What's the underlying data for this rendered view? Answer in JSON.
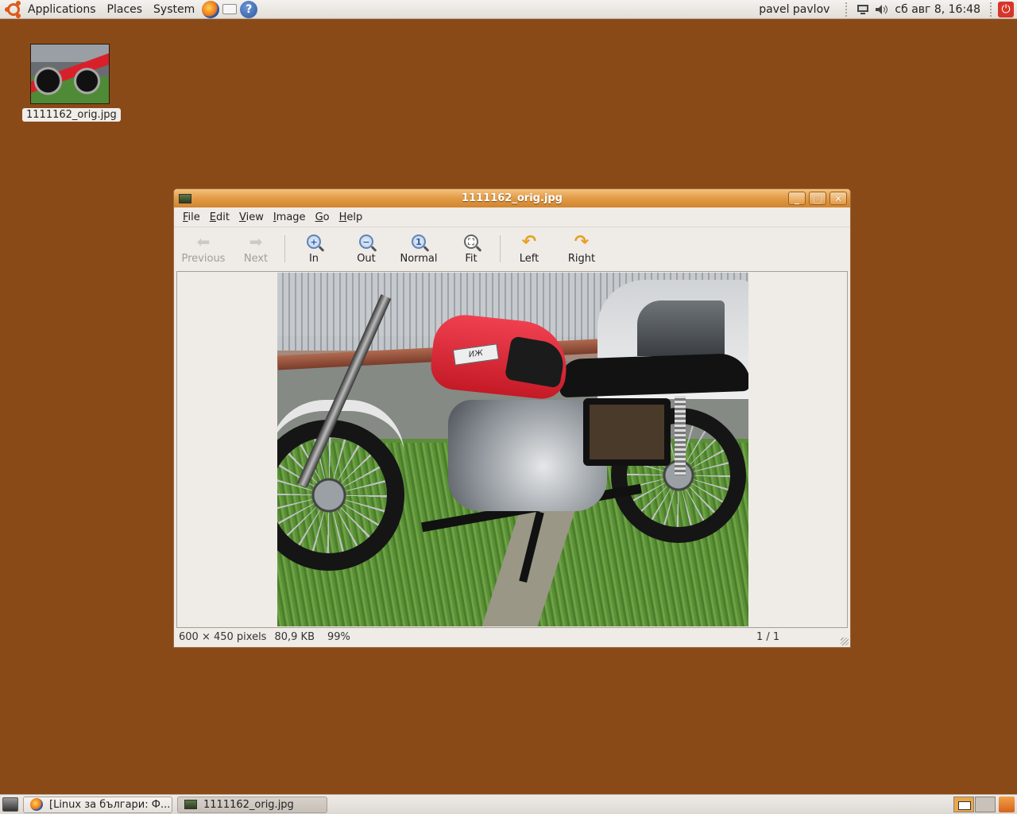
{
  "top_panel": {
    "menus": [
      "Applications",
      "Places",
      "System"
    ],
    "user_name": "pavel pavlov",
    "clock": "сб авг  8, 16:48"
  },
  "desktop": {
    "icon_label": "1111162_orig.jpg"
  },
  "window": {
    "title": "1111162_orig.jpg",
    "menu": [
      {
        "label": "File",
        "mnemonic": "F"
      },
      {
        "label": "Edit",
        "mnemonic": "E"
      },
      {
        "label": "View",
        "mnemonic": "V"
      },
      {
        "label": "Image",
        "mnemonic": "I"
      },
      {
        "label": "Go",
        "mnemonic": "G"
      },
      {
        "label": "Help",
        "mnemonic": "H"
      }
    ],
    "toolbar": {
      "previous": "Previous",
      "next": "Next",
      "zoom_in": "In",
      "zoom_out": "Out",
      "zoom_normal": "Normal",
      "zoom_fit": "Fit",
      "rotate_left": "Left",
      "rotate_right": "Right"
    },
    "photo_badge": "ИЖ",
    "status": {
      "dimensions": "600 × 450 pixels",
      "file_size": "80,9 KB",
      "zoom": "99%",
      "position": "1 / 1"
    }
  },
  "taskbar": {
    "tasks": [
      "[Linux за българи: Ф...",
      "1111162_orig.jpg"
    ]
  }
}
